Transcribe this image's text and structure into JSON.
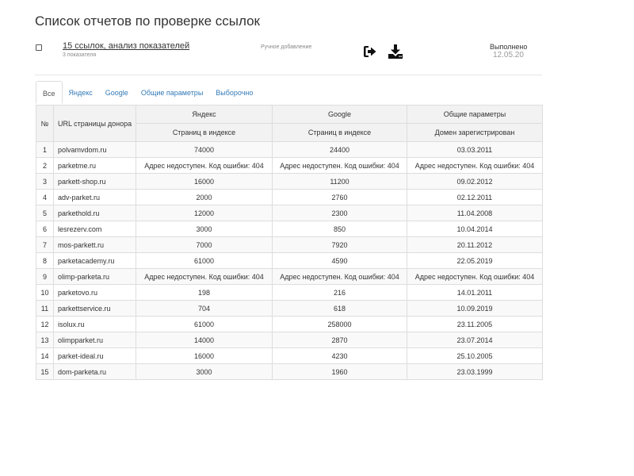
{
  "page": {
    "title": "Список отчетов по проверке ссылок"
  },
  "report": {
    "link_text": "15 ссылок, анализ показателей",
    "subtitle": "3 показателя",
    "method": "Ручное добавление",
    "status_label": "Выполнено",
    "status_date": "12.05.20",
    "icons": [
      "sign-in-icon",
      "download-icon"
    ]
  },
  "tabs": [
    {
      "label": "Все",
      "active": true
    },
    {
      "label": "Яндекс",
      "active": false
    },
    {
      "label": "Google",
      "active": false
    },
    {
      "label": "Общие параметры",
      "active": false
    },
    {
      "label": "Выборочно",
      "active": false
    }
  ],
  "table": {
    "headers": {
      "num": "№",
      "url": "URL страницы донора",
      "yandex": "Яндекс",
      "google": "Google",
      "general": "Общие параметры",
      "yandex_sub": "Страниц в индексе",
      "google_sub": "Страниц в индексе",
      "general_sub": "Домен зарегистрирован"
    },
    "rows": [
      {
        "num": "1",
        "url": "polvamvdom.ru",
        "yandex": "74000",
        "google": "24400",
        "general": "03.03.2011"
      },
      {
        "num": "2",
        "url": "parketme.ru",
        "yandex": "Адрес недоступен. Код ошибки: 404",
        "google": "Адрес недоступен. Код ошибки: 404",
        "general": "Адрес недоступен. Код ошибки: 404"
      },
      {
        "num": "3",
        "url": "parkett-shop.ru",
        "yandex": "16000",
        "google": "11200",
        "general": "09.02.2012"
      },
      {
        "num": "4",
        "url": "adv-parket.ru",
        "yandex": "2000",
        "google": "2760",
        "general": "02.12.2011"
      },
      {
        "num": "5",
        "url": "parkethold.ru",
        "yandex": "12000",
        "google": "2300",
        "general": "11.04.2008"
      },
      {
        "num": "6",
        "url": "lesrezerv.com",
        "yandex": "3000",
        "google": "850",
        "general": "10.04.2014"
      },
      {
        "num": "7",
        "url": "mos-parkett.ru",
        "yandex": "7000",
        "google": "7920",
        "general": "20.11.2012"
      },
      {
        "num": "8",
        "url": "parketacademy.ru",
        "yandex": "61000",
        "google": "4590",
        "general": "22.05.2019"
      },
      {
        "num": "9",
        "url": "olimp-parketa.ru",
        "yandex": "Адрес недоступен. Код ошибки: 404",
        "google": "Адрес недоступен. Код ошибки: 404",
        "general": "Адрес недоступен. Код ошибки: 404"
      },
      {
        "num": "10",
        "url": "parketovo.ru",
        "yandex": "198",
        "google": "216",
        "general": "14.01.2011"
      },
      {
        "num": "11",
        "url": "parkettservice.ru",
        "yandex": "704",
        "google": "618",
        "general": "10.09.2019"
      },
      {
        "num": "12",
        "url": "isolux.ru",
        "yandex": "61000",
        "google": "258000",
        "general": "23.11.2005"
      },
      {
        "num": "13",
        "url": "olimpparket.ru",
        "yandex": "14000",
        "google": "2870",
        "general": "23.07.2014"
      },
      {
        "num": "14",
        "url": "parket-ideal.ru",
        "yandex": "16000",
        "google": "4230",
        "general": "25.10.2005"
      },
      {
        "num": "15",
        "url": "dom-parketa.ru",
        "yandex": "3000",
        "google": "1960",
        "general": "23.03.1999"
      }
    ]
  },
  "colors": {
    "link": "#337ab7",
    "border": "#dddddd",
    "header_bg": "#f2f2f2",
    "stripe_bg": "#f9f9f9"
  }
}
